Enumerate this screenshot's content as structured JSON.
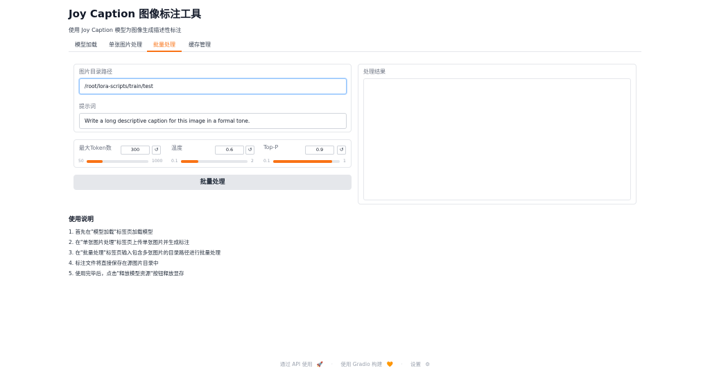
{
  "app": {
    "title": "Joy Caption 图像标注工具",
    "subtitle": "使用 Joy Caption 模型为图像生成描述性标注"
  },
  "tabs": [
    {
      "label": "模型加载",
      "active": false
    },
    {
      "label": "单张图片处理",
      "active": false
    },
    {
      "label": "批量处理",
      "active": true
    },
    {
      "label": "缓存管理",
      "active": false
    }
  ],
  "batch": {
    "dir_label": "图片目录路径",
    "dir_value": "/root/lora-scripts/train/test",
    "prompt_label": "提示词",
    "prompt_value": "Write a long descriptive caption for this image in a formal tone.",
    "sliders": [
      {
        "label": "最大Token数",
        "value": "300",
        "min": "50",
        "max": "1000",
        "fraction": 0.263
      },
      {
        "label": "温度",
        "value": "0.6",
        "min": "0.1",
        "max": "2",
        "fraction": 0.263
      },
      {
        "label": "Top-P",
        "value": "0.9",
        "min": "0.1",
        "max": "1",
        "fraction": 0.889
      }
    ],
    "reset_glyph": "↺",
    "submit_label": "批量处理"
  },
  "result": {
    "label": "处理结果",
    "value": ""
  },
  "instructions": {
    "title": "使用说明",
    "items": [
      "1. 首先在\"模型加载\"标签页加载模型",
      "2. 在\"单张图片处理\"标签页上传单张图片并生成标注",
      "3. 在\"批量处理\"标签页输入包含多张图片的目录路径进行批量处理",
      "4. 标注文件将直接保存在源图片目录中",
      "5. 使用完毕后，点击\"释放模型资源\"按钮释放显存"
    ]
  },
  "footer": {
    "api_label": "通过 API 使用",
    "api_icon": "🚀",
    "built_label": "使用 Gradio 构建",
    "built_icon": "🧡",
    "settings_label": "设置",
    "settings_icon": "⚙",
    "separator": "·"
  }
}
